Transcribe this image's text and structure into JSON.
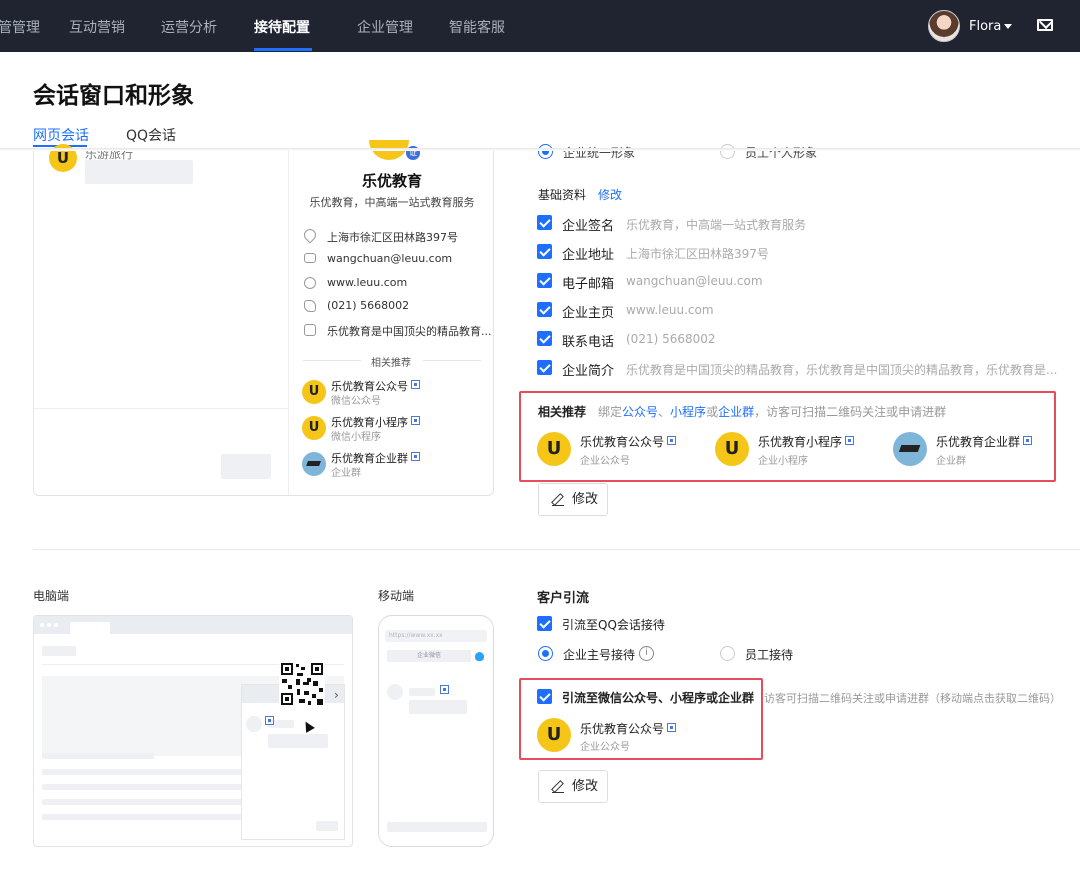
{
  "nav": {
    "items": [
      "管管理",
      "互动营销",
      "运营分析",
      "接待配置",
      "企业管理",
      "智能客服"
    ],
    "active_index": 3,
    "user_name": "Flora",
    "active_color": "#1e6fff",
    "bg_color": "#1f2430"
  },
  "page": {
    "title": "会话窗口和形象",
    "tabs": [
      "网页会话",
      "QQ会话"
    ],
    "active_tab": 0
  },
  "preview": {
    "top_name": "乐游旅行",
    "company_name": "乐优教育",
    "badge": "证",
    "company_desc": "乐优教育，中高端一站式教育服务",
    "address": "上海市徐汇区田林路397号",
    "email": "wangchuan@leuu.com",
    "website": "www.leuu.com",
    "phone": "(021) 5668002",
    "intro": "乐优教育是中国顶尖的精品教育...",
    "rec_title": "相关推荐",
    "recs": [
      {
        "name": "乐优教育公众号",
        "type": "微信公众号",
        "logo": "U"
      },
      {
        "name": "乐优教育小程序",
        "type": "微信小程序",
        "logo": "U"
      },
      {
        "name": "乐优教育企业群",
        "type": "企业群",
        "logo": "cap"
      }
    ]
  },
  "form": {
    "image_options": [
      "企业统一形象",
      "员工个人形象"
    ],
    "basic_title": "基础资料",
    "basic_edit": "修改",
    "fields": [
      {
        "label": "企业签名",
        "value": "乐优教育，中高端一站式教育服务",
        "checked": true
      },
      {
        "label": "企业地址",
        "value": "上海市徐汇区田林路397号",
        "checked": true
      },
      {
        "label": "电子邮箱",
        "value": "wangchuan@leuu.com",
        "checked": true
      },
      {
        "label": "企业主页",
        "value": "www.leuu.com",
        "checked": true
      },
      {
        "label": "联系电话",
        "value": "(021) 5668002",
        "checked": true
      },
      {
        "label": "企业简介",
        "value": "乐优教育是中国顶尖的精品教育，乐优教育是中国顶尖的精品教育，乐优教育是...",
        "checked": true
      }
    ],
    "rec_label": "相关推荐",
    "rec_hint_pre": "绑定",
    "rec_hint_link1": "公众号",
    "rec_hint_sep": "、",
    "rec_hint_link2": "小程序",
    "rec_hint_or": "或",
    "rec_hint_link3": "企业群",
    "rec_hint_post": "，访客可扫描二维码关注或申请进群",
    "rec_items": [
      {
        "name": "乐优教育公众号",
        "type": "企业公众号",
        "logo": "U"
      },
      {
        "name": "乐优教育小程序",
        "type": "企业小程序",
        "logo": "U"
      },
      {
        "name": "乐优教育企业群",
        "type": "企业群",
        "logo": "cap"
      }
    ],
    "edit_button": "修改"
  },
  "lower": {
    "desktop_label": "电脑端",
    "mobile_label": "移动端",
    "mobile_url": "https://www.xx.xx",
    "mobile_bar_text": "企业微信",
    "section_title": "客户引流",
    "qq_option": "引流至QQ会话接待",
    "qq_option_checked": true,
    "recv_options": [
      "企业主号接待",
      "员工接待"
    ],
    "recv_selected": 0,
    "wechat_option": "引流至微信公众号、小程序或企业群",
    "wechat_checked": true,
    "wechat_hint": "访客可扫描二维码关注或申请进群（移动端点击获取二维码）",
    "wechat_item": {
      "name": "乐优教育公众号",
      "type": "企业公众号",
      "logo": "U"
    },
    "edit_button": "修改"
  }
}
